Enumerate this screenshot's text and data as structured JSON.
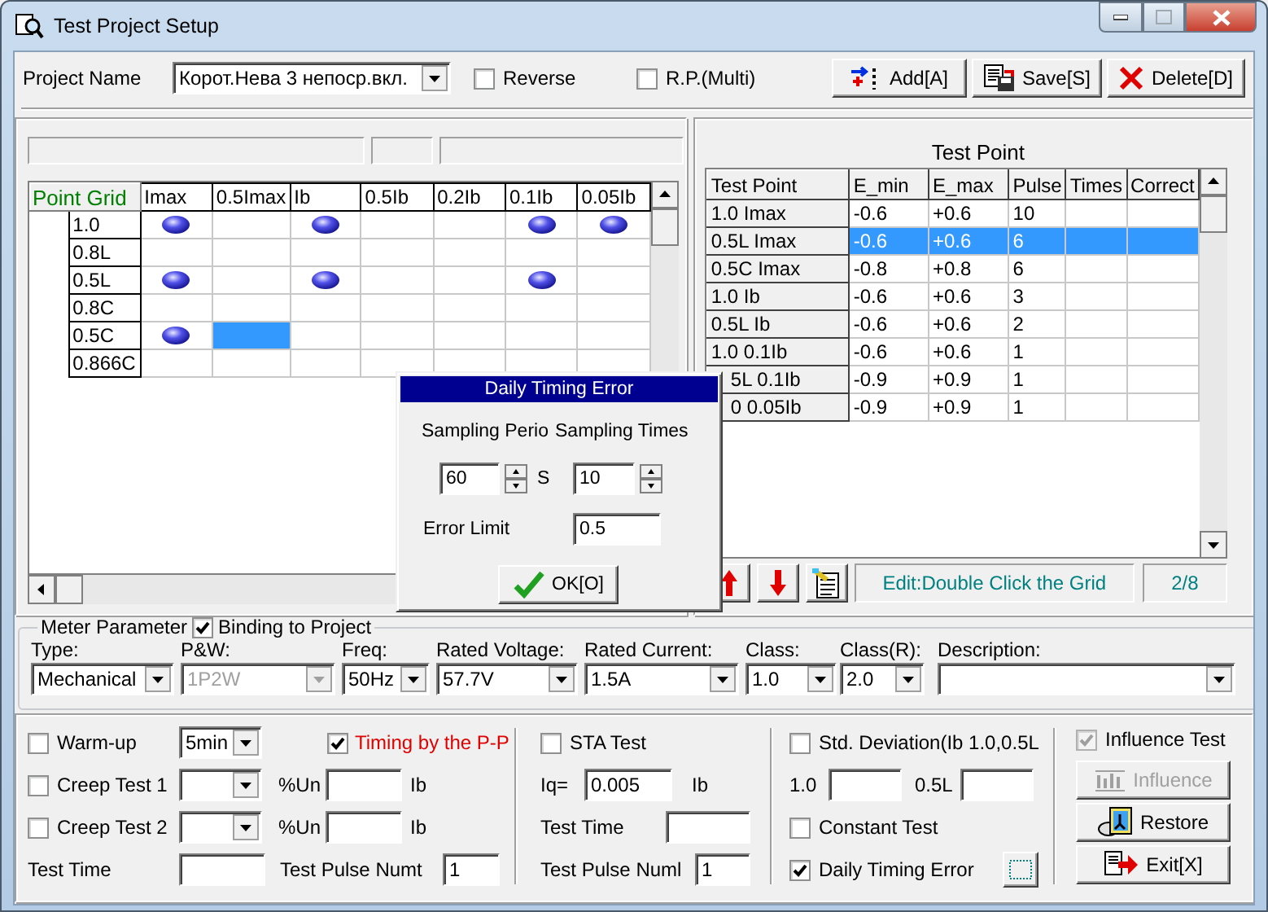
{
  "window": {
    "title": "Test Project Setup"
  },
  "project": {
    "label": "Project Name",
    "value": "Корот.Нева 3 непоср.вкл.",
    "options": [
      {
        "label": "Reverse",
        "checked": false
      },
      {
        "label": "R.P.(Multi)",
        "checked": false
      }
    ]
  },
  "toolbar": [
    {
      "label": "Add[A]",
      "kind": "add"
    },
    {
      "label": "Save[S]",
      "kind": "save"
    },
    {
      "label": "Delete[D]",
      "kind": "delete"
    }
  ],
  "point_grid": {
    "corner": "Point Grid",
    "columns": [
      "Imax",
      "0.5Imax",
      "Ib",
      "0.5Ib",
      "0.2Ib",
      "0.1Ib",
      "0.05Ib"
    ],
    "rows": [
      {
        "label": "1.0",
        "cells": [
          {
            "point": true,
            "selected": false
          },
          {
            "point": false,
            "selected": false
          },
          {
            "point": true,
            "selected": false
          },
          {
            "point": false,
            "selected": false
          },
          {
            "point": false,
            "selected": false
          },
          {
            "point": true,
            "selected": false
          },
          {
            "point": true,
            "selected": false
          }
        ]
      },
      {
        "label": "0.8L",
        "cells": [
          {
            "point": false,
            "selected": false
          },
          {
            "point": false,
            "selected": false
          },
          {
            "point": false,
            "selected": false
          },
          {
            "point": false,
            "selected": false
          },
          {
            "point": false,
            "selected": false
          },
          {
            "point": false,
            "selected": false
          },
          {
            "point": false,
            "selected": false
          }
        ]
      },
      {
        "label": "0.5L",
        "cells": [
          {
            "point": true,
            "selected": false
          },
          {
            "point": false,
            "selected": false
          },
          {
            "point": true,
            "selected": false
          },
          {
            "point": false,
            "selected": false
          },
          {
            "point": false,
            "selected": false
          },
          {
            "point": true,
            "selected": false
          },
          {
            "point": false,
            "selected": false
          }
        ]
      },
      {
        "label": "0.8C",
        "cells": [
          {
            "point": false,
            "selected": false
          },
          {
            "point": false,
            "selected": false
          },
          {
            "point": false,
            "selected": false
          },
          {
            "point": false,
            "selected": false
          },
          {
            "point": false,
            "selected": false
          },
          {
            "point": false,
            "selected": false
          },
          {
            "point": false,
            "selected": false
          }
        ]
      },
      {
        "label": "0.5C",
        "cells": [
          {
            "point": true,
            "selected": false
          },
          {
            "point": false,
            "selected": true
          },
          {
            "point": false,
            "selected": false
          },
          {
            "point": false,
            "selected": false
          },
          {
            "point": false,
            "selected": false
          },
          {
            "point": false,
            "selected": false
          },
          {
            "point": false,
            "selected": false
          }
        ]
      },
      {
        "label": "0.866C",
        "cells": [
          {
            "point": false,
            "selected": false
          },
          {
            "point": false,
            "selected": false
          },
          {
            "point": false,
            "selected": false
          },
          {
            "point": false,
            "selected": false
          },
          {
            "point": false,
            "selected": false
          },
          {
            "point": false,
            "selected": false
          },
          {
            "point": false,
            "selected": false
          }
        ]
      }
    ]
  },
  "test_point": {
    "title": "Test Point",
    "columns": [
      "Test Point",
      "E_min",
      "E_max",
      "Pulse",
      "Times",
      "Correct"
    ],
    "rows": [
      {
        "cells": [
          "1.0 Imax",
          "-0.6",
          "+0.6",
          "10"
        ],
        "selected": false
      },
      {
        "cells": [
          "0.5L Imax",
          "-0.6",
          "+0.6",
          "6"
        ],
        "selected": true
      },
      {
        "cells": [
          "0.5C Imax",
          "-0.8",
          "+0.8",
          "6"
        ],
        "selected": false
      },
      {
        "cells": [
          "1.0 Ib",
          "-0.6",
          "+0.6",
          "3"
        ],
        "selected": false
      },
      {
        "cells": [
          "0.5L Ib",
          "-0.6",
          "+0.6",
          "2"
        ],
        "selected": false
      },
      {
        "cells": [
          "1.0 0.1Ib",
          "-0.6",
          "+0.6",
          "1"
        ],
        "selected": false
      },
      {
        "cells": [
          "5L 0.1Ib",
          "-0.9",
          "+0.9",
          "1"
        ],
        "selected": false
      },
      {
        "cells": [
          "0 0.05Ib",
          "-0.9",
          "+0.9",
          "1"
        ],
        "selected": false
      }
    ],
    "hint": "Edit:Double Click the Grid",
    "counter": "2/8"
  },
  "dialog": {
    "title": "Daily Timing Error",
    "period_label": "Sampling Perio",
    "times_label": "Sampling Times",
    "period": "60",
    "unit": "S",
    "times": "10",
    "limit_label": "Error Limit",
    "limit": "0.5",
    "ok": "OK[O]"
  },
  "meter": {
    "title": "Meter Parameter",
    "binding": {
      "label": "Binding to Project",
      "checked": true
    },
    "fields": [
      {
        "label": "Type:",
        "value": "Mechanical",
        "disabled": false
      },
      {
        "label": "P&W:",
        "value": "1P2W",
        "disabled": true
      },
      {
        "label": "Freq:",
        "value": "50Hz",
        "disabled": false
      },
      {
        "label": "Rated Voltage:",
        "value": "57.7V",
        "disabled": false
      },
      {
        "label": "Rated Current:",
        "value": "1.5A",
        "disabled": false
      },
      {
        "label": "Class:",
        "value": "1.0",
        "disabled": false
      },
      {
        "label": "Class(R):",
        "value": "2.0",
        "disabled": false
      },
      {
        "label": "Description:",
        "disabled": false
      }
    ]
  },
  "warmup": {
    "label": "Warm-up",
    "checked": false,
    "value": "5min"
  },
  "timing_pp": {
    "label": "Timing by the P-P",
    "checked": true
  },
  "creep": [
    {
      "label": "Creep Test 1",
      "checked": false,
      "unit": "%Un",
      "current": "Ib"
    },
    {
      "label": "Creep Test 2",
      "checked": false,
      "unit": "%Un",
      "current": "Ib"
    }
  ],
  "test_time_label": "Test Time",
  "pulse_label": "Test Pulse Numt",
  "pulse": "1",
  "sta": {
    "label": "STA Test",
    "checked": false,
    "iq_label": "Iq=",
    "iq": "0.005",
    "iq_unit": "Ib",
    "time_label": "Test Time",
    "pulse_label": "Test Pulse Numl",
    "pulse": "1"
  },
  "std_dev": {
    "label": "Std. Deviation(Ib 1.0,0.5L",
    "checked": false,
    "a_label": "1.0",
    "b_label": "0.5L"
  },
  "constant": {
    "label": "Constant Test",
    "checked": false
  },
  "daily": {
    "label": "Daily Timing Error",
    "checked": true
  },
  "influence": {
    "label": "Influence Test",
    "checked": true,
    "disabled": true
  },
  "side_buttons": [
    {
      "label": "Influence",
      "kind": "chart",
      "disabled": true
    },
    {
      "label": "Restore",
      "kind": "restore",
      "disabled": false
    },
    {
      "label": "Exit[X]",
      "kind": "exit",
      "disabled": false
    }
  ]
}
